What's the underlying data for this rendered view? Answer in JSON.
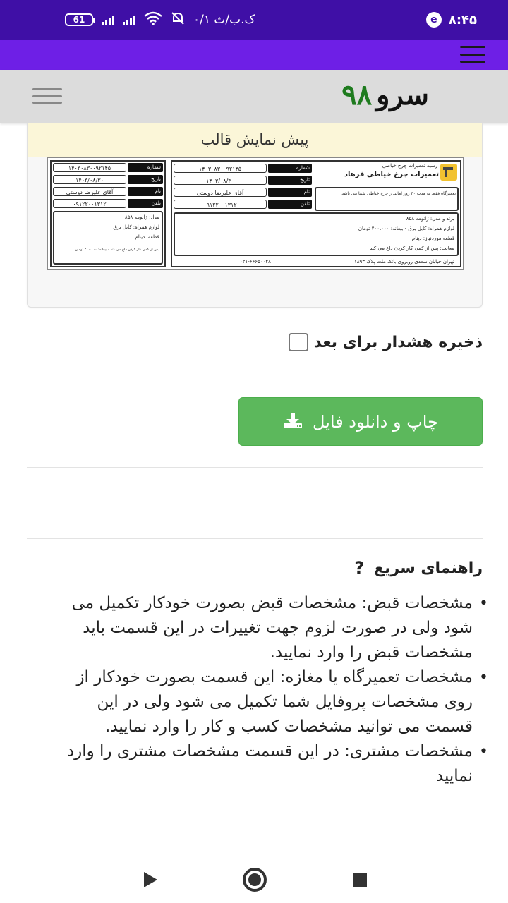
{
  "status_bar": {
    "battery": "61",
    "network_text": "۰/۱ ک.ب/ث",
    "app_badge": "e",
    "time": "۸:۴۵"
  },
  "site": {
    "logo_word": "سرو",
    "logo_number": "۹۸"
  },
  "preview": {
    "title": "پیش نمایش قالب",
    "receipt": {
      "header_caption": "رسید تعمیرات چرخ خیاطی",
      "shop_name": "تعمیرات چرخ خیاطی فرهاد",
      "shop_note": "تعمیرگاه فقط به مدت ۳۰ روز امانتدار چرخ خیاطی شما می باشد",
      "labels": {
        "number": "شماره",
        "date": "تاریخ",
        "name": "نام",
        "phone": "تلفن"
      },
      "values": {
        "number": "۱۴۰۳۰۸۳۰۰۹۲۱۴۵",
        "date": "۱۴۰۳/۰۸/۳۰",
        "name": "آقای علیرضا دوستی",
        "phone": "۰۹۱۲۲۰۰۱۳۱۲"
      },
      "details": {
        "model": "برند و مدل: ژانومه ۸۵۸",
        "accessories": "لوازم همراه: کابل برق - بیعانه: ۴۰۰،۰۰۰ تومان",
        "part": "قطعه موردنیاز: دینام",
        "issue": "معایب: پس از کمی کار کردن داغ می کند"
      },
      "stub_details": {
        "model": "مدل: ژانومه ۸۵۸",
        "accessories": "لوازم همراه: کابل برق",
        "part": "قطعه: دینام",
        "issue": "پس از کمی کار کردن داغ می کند - بیعانه: ۴۰۰،۰۰۰ تومان"
      },
      "address": "تهران خیابان سعدی روبروی بانک ملت پلاک ۱۸۹۳",
      "footer_phone": "۰۲۱-۶۶۶۵۰۰۲۸"
    }
  },
  "save_warning": {
    "label": "ذخیره هشدار برای بعد",
    "checked": false
  },
  "print_button": {
    "label": "چاپ و دانلود فایل",
    "color": "#5cb85c"
  },
  "help": {
    "title": "راهنمای سریع",
    "items": [
      "مشخصات قبض: مشخصات قبض بصورت خودکار تکمیل می شود ولی در صورت لزوم جهت تغییرات در این قسمت باید مشخصات قبض را وارد نمایید.",
      "مشخصات تعمیرگاه یا مغازه: این قسمت بصورت خودکار از روی مشخصات پروفایل شما تکمیل می شود ولی در این قسمت می توانید مشخصات کسب و کار را وارد نمایید.",
      "مشخصات مشتری: در این قسمت مشخصات مشتری را وارد نمایید"
    ]
  },
  "colors": {
    "status_bar": "#3f0fa6",
    "app_bar": "#6e1fe6",
    "header_bg": "#dcdcdc",
    "logo_number": "#1e7b1e"
  }
}
